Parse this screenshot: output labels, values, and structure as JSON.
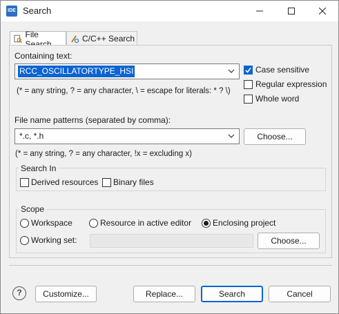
{
  "window": {
    "app_icon": "IDE",
    "title": "Search",
    "controls": {
      "minimize": "minimize-icon",
      "maximize": "maximize-icon",
      "close": "close-icon"
    }
  },
  "tabs": [
    {
      "label": "File Search",
      "icon": "file-search-icon",
      "active": true
    },
    {
      "label": "C/C++ Search",
      "icon": "cpp-search-icon",
      "active": false
    }
  ],
  "containing_text": {
    "label": "Containing text:",
    "value": "RCC_OSCILLATORTYPE_HSI",
    "hint": "(* = any string, ? = any character, \\ = escape for literals: * ? \\)"
  },
  "options": {
    "case_sensitive": {
      "label": "Case sensitive",
      "checked": true
    },
    "regular_expression": {
      "label": "Regular expression",
      "checked": false
    },
    "whole_word": {
      "label": "Whole word",
      "checked": false
    }
  },
  "file_patterns": {
    "label": "File name patterns (separated by comma):",
    "value": "*.c, *.h",
    "hint": "(* = any string, ? = any character, !x = excluding x)",
    "choose_label": "Choose..."
  },
  "search_in": {
    "title": "Search In",
    "derived_resources": {
      "label": "Derived resources",
      "checked": false
    },
    "binary_files": {
      "label": "Binary files",
      "checked": false
    }
  },
  "scope": {
    "title": "Scope",
    "workspace": {
      "label": "Workspace",
      "selected": false
    },
    "resource_in_editor": {
      "label": "Resource in active editor",
      "selected": false
    },
    "enclosing_project": {
      "label": "Enclosing project",
      "selected": true
    },
    "working_set": {
      "label": "Working set:",
      "selected": false,
      "value": ""
    },
    "choose_label": "Choose..."
  },
  "footer": {
    "help": "?",
    "customize": "Customize...",
    "replace": "Replace...",
    "search": "Search",
    "cancel": "Cancel"
  },
  "colors": {
    "accent": "#0a64d2",
    "background": "#f0f0f0"
  }
}
